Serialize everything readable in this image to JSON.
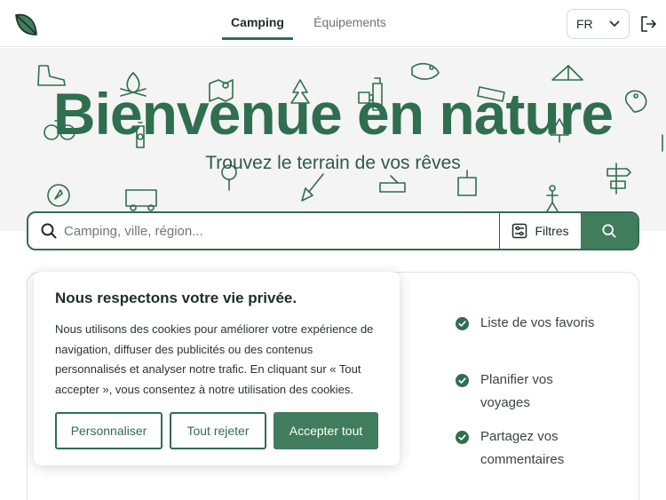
{
  "header": {
    "tabs": [
      {
        "label": "Camping",
        "active": true
      },
      {
        "label": "Équipements",
        "active": false
      }
    ],
    "language": "FR"
  },
  "hero": {
    "title": "Bienvenue en nature",
    "subtitle": "Trouvez le terrain de vos rêves"
  },
  "search": {
    "placeholder": "Camping, ville, région...",
    "filters_label": "Filtres"
  },
  "features": [
    {
      "lines": [
        "Liste de vos favoris"
      ]
    },
    {
      "lines": [
        "Planifier vos",
        "voyages"
      ]
    },
    {
      "lines": [
        "Partagez vos",
        "commentaires"
      ]
    }
  ],
  "cookie": {
    "title": "Nous respectons votre vie privée.",
    "lines": [
      "Nous utilisons des cookies pour améliorer votre expérience de",
      "navigation, diffuser des publicités ou des contenus",
      "personnalisés et analyser notre trafic. En cliquant sur « Tout",
      "accepter », vous consentez à notre utilisation des cookies."
    ],
    "customize_label": "Personnaliser",
    "reject_label": "Tout rejeter",
    "accept_label": "Accepter tout"
  },
  "colors": {
    "brand": "#2f6e4f",
    "accent_button": "#3f7d5d",
    "hero_bg": "#f3f4f3"
  }
}
